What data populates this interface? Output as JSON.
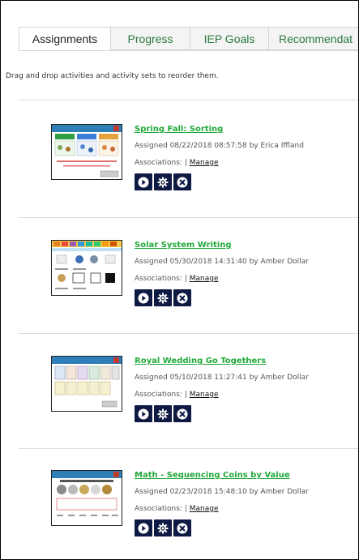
{
  "tabs": [
    {
      "label": "Assignments",
      "active": true
    },
    {
      "label": "Progress",
      "active": false
    },
    {
      "label": "IEP Goals",
      "active": false
    },
    {
      "label": "Recommendat",
      "active": false
    }
  ],
  "instructions": "Drag and drop activities and activity sets to reorder them.",
  "associations_label": "Associations:",
  "associations_separator": "|",
  "manage_label": "Manage",
  "actions": [
    "play-icon",
    "settings-gear-icon",
    "remove-icon"
  ],
  "colors": {
    "title_link": "#21a93a",
    "action_button": "#0f1a44",
    "tab_link": "#2b7a3f"
  },
  "assignments": [
    {
      "title": "Spring Fall: Sorting",
      "assigned": "Assigned 08/22/2018 08:57:58 by Erica Iffland"
    },
    {
      "title": "Solar System Writing",
      "assigned": "Assigned 05/30/2018 14:31:40 by Amber Dollar"
    },
    {
      "title": "Royal Wedding Go Togethers",
      "assigned": "Assigned 05/10/2018 11:27:41 by Amber Dollar"
    },
    {
      "title": "Math - Sequencing Coins by Value",
      "assigned": "Assigned 02/23/2018 15:48:10 by Amber Dollar"
    }
  ]
}
